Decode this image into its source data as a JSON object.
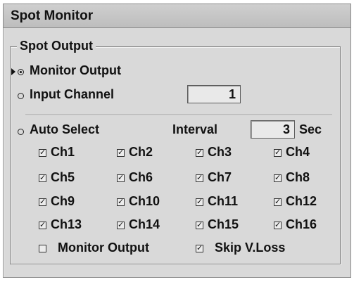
{
  "window": {
    "title": "Spot Monitor"
  },
  "group": {
    "legend": "Spot Output"
  },
  "options": {
    "monitor_output": {
      "label": "Monitor Output",
      "selected": true
    },
    "input_channel": {
      "label": "Input Channel",
      "value": "1",
      "selected": false
    },
    "auto_select": {
      "label": "Auto Select",
      "selected": false
    }
  },
  "interval": {
    "label": "Interval",
    "value": "3",
    "unit": "Sec"
  },
  "channels": [
    {
      "label": "Ch1",
      "checked": true
    },
    {
      "label": "Ch2",
      "checked": true
    },
    {
      "label": "Ch3",
      "checked": true
    },
    {
      "label": "Ch4",
      "checked": true
    },
    {
      "label": "Ch5",
      "checked": true
    },
    {
      "label": "Ch6",
      "checked": true
    },
    {
      "label": "Ch7",
      "checked": true
    },
    {
      "label": "Ch8",
      "checked": true
    },
    {
      "label": "Ch9",
      "checked": true
    },
    {
      "label": "Ch10",
      "checked": true
    },
    {
      "label": "Ch11",
      "checked": true
    },
    {
      "label": "Ch12",
      "checked": true
    },
    {
      "label": "Ch13",
      "checked": true
    },
    {
      "label": "Ch14",
      "checked": true
    },
    {
      "label": "Ch15",
      "checked": true
    },
    {
      "label": "Ch16",
      "checked": true
    }
  ],
  "bottom": {
    "monitor_output": {
      "label": "Monitor Output",
      "checked": false
    },
    "skip_vloss": {
      "label": "Skip V.Loss",
      "checked": true
    }
  },
  "glyphs": {
    "check": "✓"
  }
}
